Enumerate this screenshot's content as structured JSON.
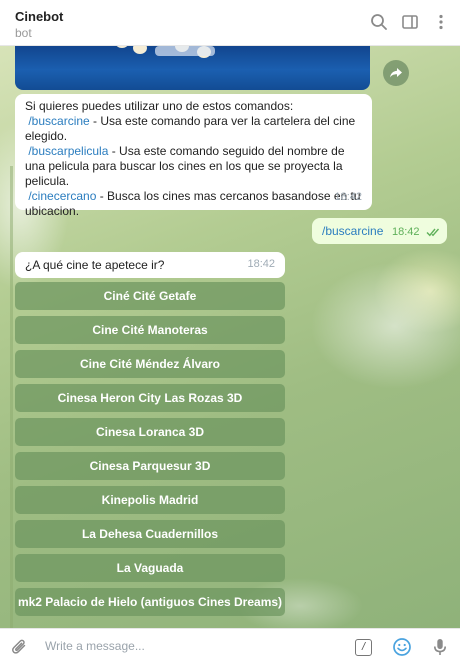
{
  "header": {
    "title": "Cinebot",
    "subtitle": "bot",
    "icons": [
      "search-icon",
      "sidebar-icon",
      "more-icon"
    ]
  },
  "messages": {
    "commands": {
      "intro": "Si quieres puedes utilizar uno de estos comandos:",
      "items": [
        {
          "command": "/buscarcine",
          "description": " - Usa este comando para ver la cartelera del cine elegido."
        },
        {
          "command": "/buscarpelicula",
          "description": " - Usa este comando seguido del nombre de una pelicula para buscar los cines en los que se proyecta la pelicula."
        },
        {
          "command": "/cinecercano",
          "description": " - Busca los cines mas cercanos basandose en tu ubicacion."
        }
      ],
      "time": "18:42"
    },
    "outgoing": {
      "text": "/buscarcine",
      "time": "18:42"
    },
    "question": {
      "text": "¿A qué cine te apetece ir?",
      "time": "18:42"
    }
  },
  "keyboard": [
    "Ciné Cité Getafe",
    "Cine Cité Manoteras",
    "Cine Cité Méndez Álvaro",
    "Cinesa Heron City Las Rozas 3D",
    "Cinesa Loranca 3D",
    "Cinesa Parquesur 3D",
    "Kinepolis Madrid",
    "La Dehesa Cuadernillos",
    "La Vaguada",
    "mk2 Palacio de Hielo (antiguos Cines Dreams)"
  ],
  "composer": {
    "placeholder": "Write a message...",
    "command_label": "/"
  },
  "colors": {
    "link": "#2b7dbf",
    "outgoing_bubble": "#effdde",
    "keyboard_button": "#6e965f"
  }
}
